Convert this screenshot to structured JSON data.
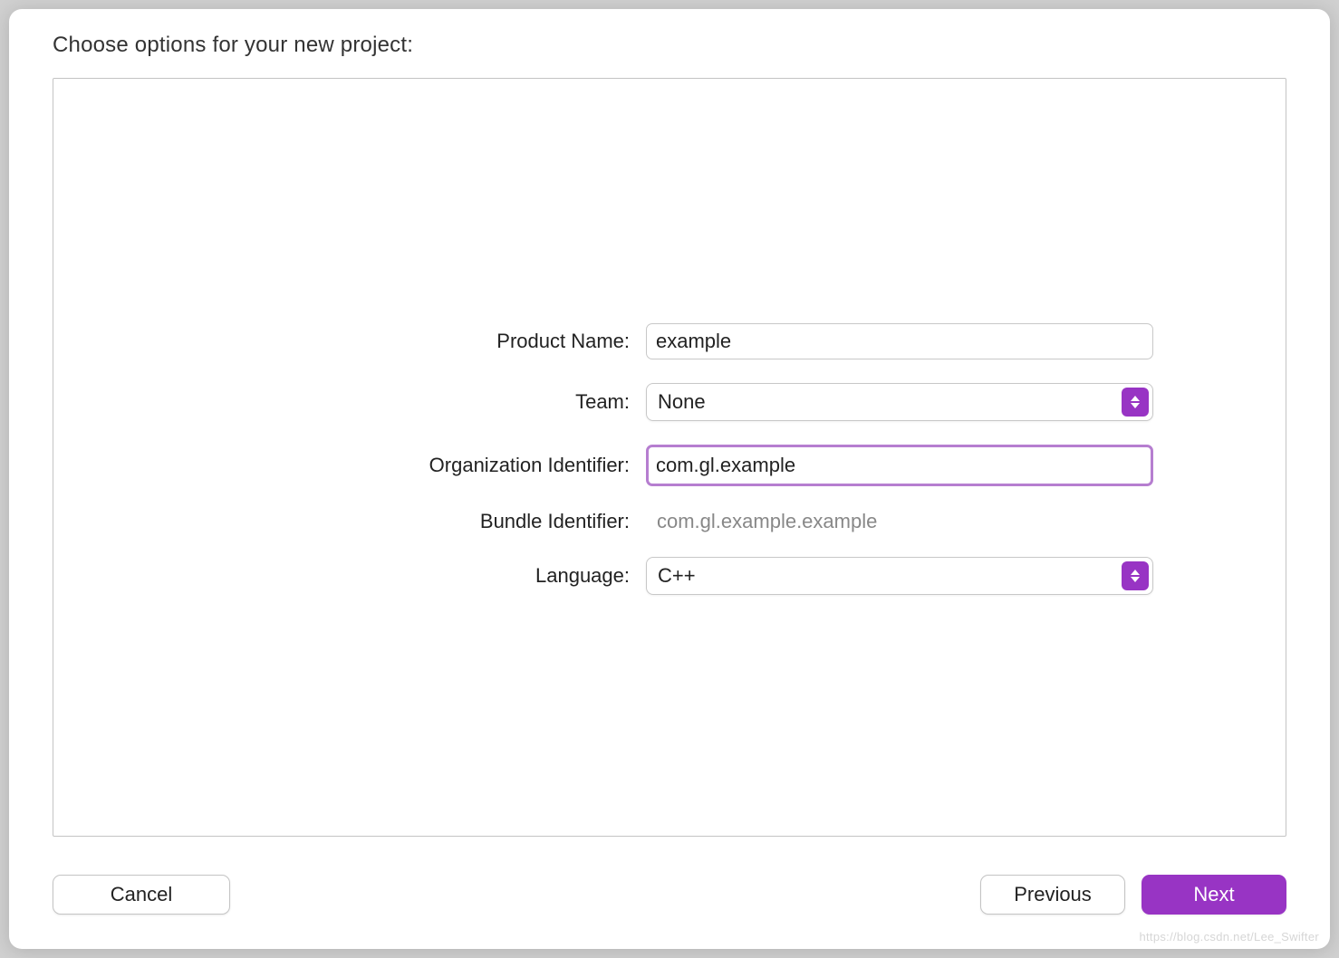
{
  "dialog": {
    "title": "Choose options for your new project:"
  },
  "fields": {
    "product_name": {
      "label": "Product Name:",
      "value": "example"
    },
    "team": {
      "label": "Team:",
      "value": "None"
    },
    "org_identifier": {
      "label": "Organization Identifier:",
      "value": "com.gl.example"
    },
    "bundle_identifier": {
      "label": "Bundle Identifier:",
      "value": "com.gl.example.example"
    },
    "language": {
      "label": "Language:",
      "value": "C++"
    }
  },
  "buttons": {
    "cancel": "Cancel",
    "previous": "Previous",
    "next": "Next"
  },
  "watermark": "https://blog.csdn.net/Lee_Swifter"
}
